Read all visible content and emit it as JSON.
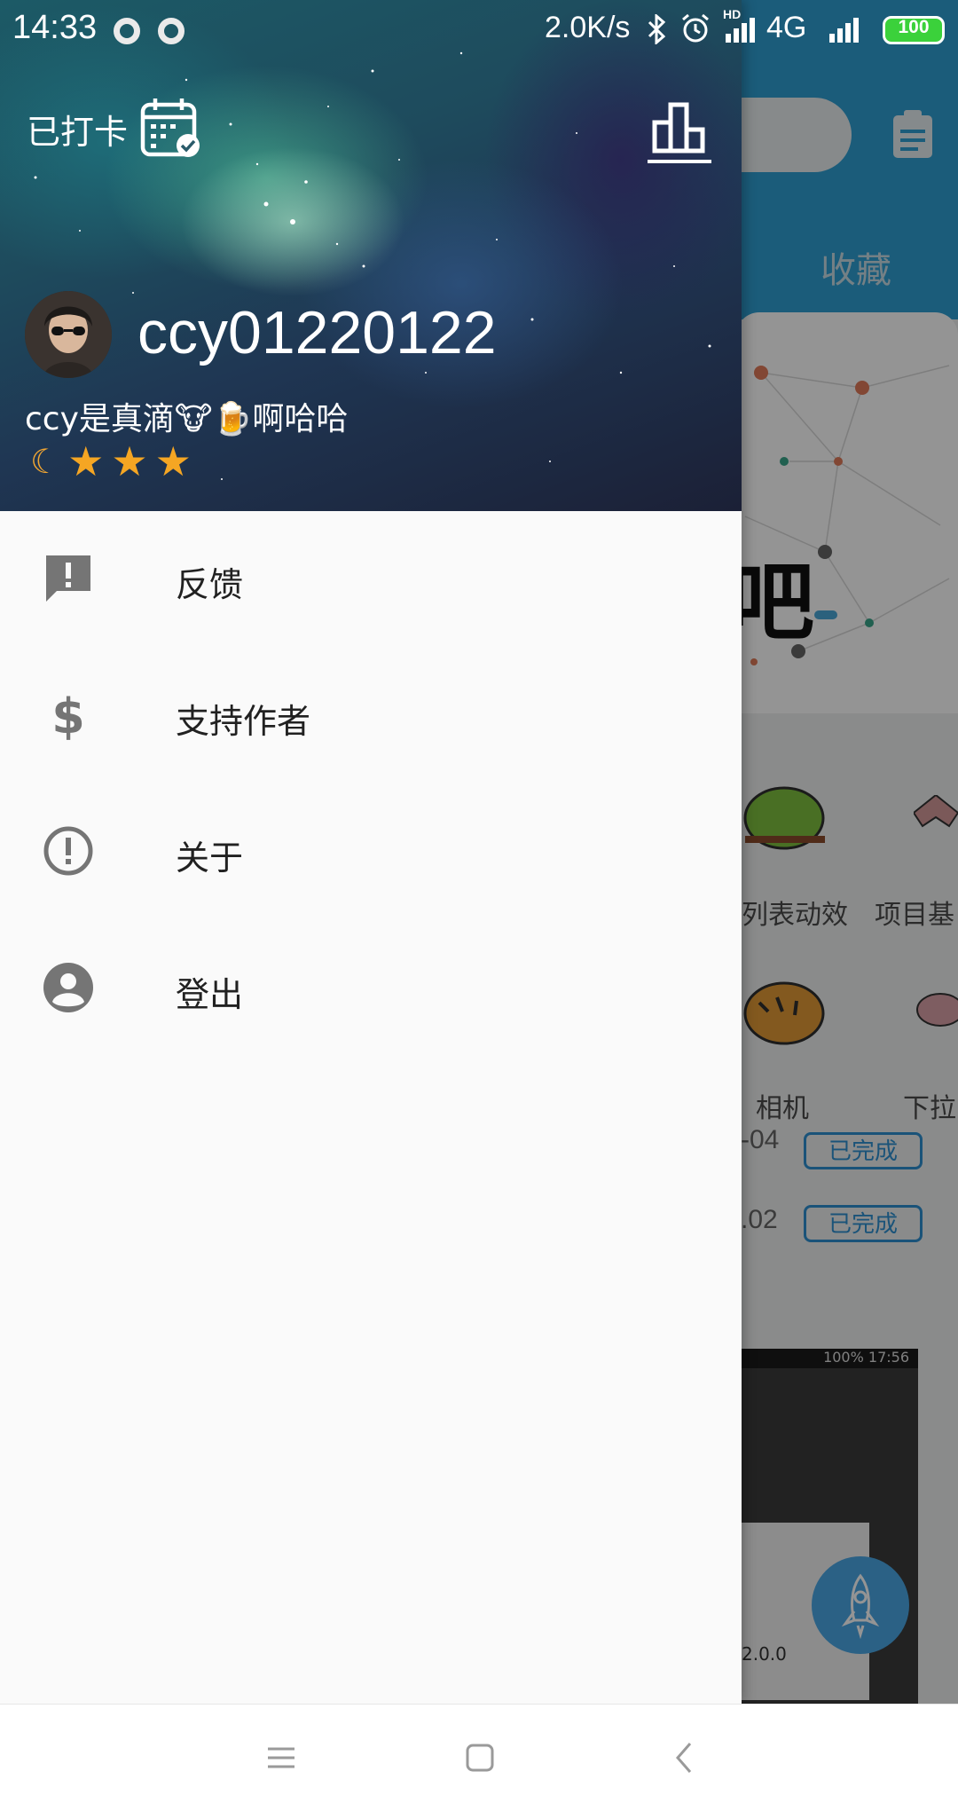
{
  "status_bar": {
    "time": "14:33",
    "speed": "2.0K/s",
    "hd_label": "HD",
    "network": "4G",
    "battery": "100"
  },
  "drawer": {
    "checkin_label": "已打卡",
    "username": "ccy01220122",
    "signature": "ccy是真滴🐮🍺啊哈哈",
    "level": {
      "moons": 1,
      "stars": 3
    },
    "menu": [
      {
        "label": "反馈",
        "icon": "feedback-icon"
      },
      {
        "label": "支持作者",
        "icon": "dollar-icon"
      },
      {
        "label": "关于",
        "icon": "info-icon"
      },
      {
        "label": "登出",
        "icon": "account-icon"
      }
    ]
  },
  "background": {
    "tab_label": "收藏",
    "banner_text": "吧",
    "grid": [
      {
        "label": "列表动效"
      },
      {
        "label": "项目基"
      },
      {
        "label": "相机"
      },
      {
        "label": "下拉"
      }
    ],
    "list": [
      {
        "date": "-04",
        "status": "已完成"
      },
      {
        "date": ".02",
        "status": "已完成"
      }
    ],
    "phone_status": "100% 17:56",
    "phone_version": "2.0.0"
  },
  "colors": {
    "accent": "#2f9fd3",
    "drawer_bg": "#fafafa",
    "menu_icon": "#757575",
    "star": "#f5a623"
  }
}
